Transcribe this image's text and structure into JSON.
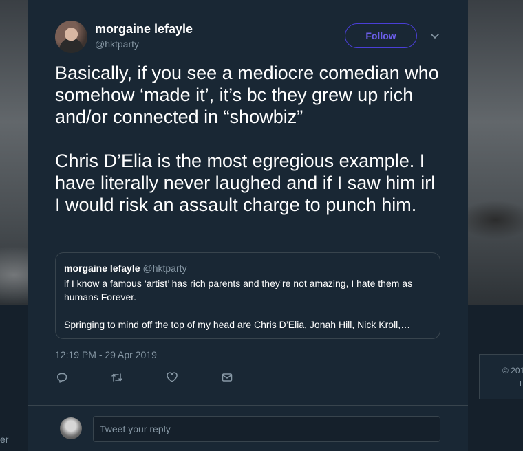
{
  "tweet": {
    "display_name": "morgaine lefayle",
    "handle": "@hktparty",
    "follow_label": "Follow",
    "paragraphs": [
      "Basically, if you see a mediocre comedian who somehow ‘made it’, it’s bc they grew up rich and/or connected in “showbiz”",
      "Chris D’Elia is the most egregious example. I have literally never laughed and if I saw him irl I would risk an assault charge to punch him."
    ],
    "timestamp": "12:19 PM - 29 Apr 2019"
  },
  "quoted_tweet": {
    "display_name": "morgaine lefayle",
    "handle": "@hktparty",
    "paragraphs": [
      "if I know a famous ‘artist’ has rich parents and they’re not amazing, I hate them as humans Forever.",
      "Springing to mind off the top of my head are Chris D’Elia, Jonah Hill, Nick Kroll,…"
    ]
  },
  "actions": {
    "reply_icon": "speech-bubble-icon",
    "retweet_icon": "retweet-icon",
    "like_icon": "heart-icon",
    "dm_icon": "envelope-icon"
  },
  "reply": {
    "placeholder": "Tweet your reply"
  },
  "side_footer": {
    "copyright_fragment": "© 201"
  },
  "left_fragment": "er",
  "colors": {
    "background": "#15202b",
    "card": "#192734",
    "border": "#38444d",
    "muted_text": "#8899a6",
    "follow_accent": "#6b5ee8"
  }
}
